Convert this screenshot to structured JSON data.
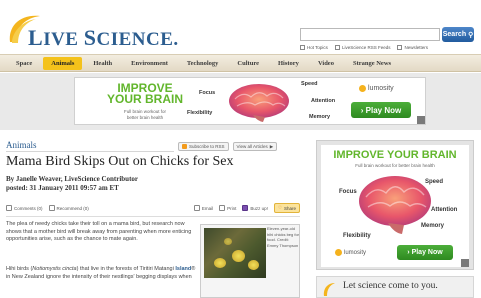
{
  "header": {
    "logo_text_part1": "L",
    "logo_text_part2": "IVE ",
    "logo_text_part3": "S",
    "logo_text_part4": "CIENCE",
    "logo_text_part5": ".",
    "search_value": "",
    "search_button_label": "Search",
    "links": [
      "Hot Topics",
      "LiveScience RSS Feeds",
      "Newsletters"
    ]
  },
  "nav": {
    "items": [
      "Space",
      "Animals",
      "Health",
      "Environment",
      "Technology",
      "Culture",
      "History",
      "Video",
      "Strange News"
    ],
    "active": "Animals"
  },
  "banner": {
    "headline_line1": "IMPROVE",
    "headline_line2": "YOUR BRAIN",
    "sub_line1": "Full brain workout for",
    "sub_line2": "better brain health",
    "labels": [
      "Focus",
      "Speed",
      "Attention",
      "Flexibility",
      "Memory"
    ],
    "brand": "lumosity",
    "cta": "› Play Now"
  },
  "article": {
    "section": "Animals",
    "subscribe_label": "Subscribe to RSS",
    "view_all_label": "View all Articles",
    "title": "Mama Bird Skips Out on Chicks for Sex",
    "byline": "By Janelle Weaver, LiveScience Contributor",
    "posted": "posted: 31 January 2011 09:57 am ET",
    "tools": {
      "comments": "Comments (0)",
      "recommend": "Recommend (0)",
      "email": "Email",
      "print": "Print",
      "buzz": "Buzz up!",
      "share": "Share"
    },
    "para1": "The plea of needy chicks take their toll on a mama bird, but research now shows that a mother bird will break away from parenting when more enticing opportunities arise, such as the chance to mate again.",
    "para2_prefix": "Hihi birds (",
    "para2_latin": "Notiomystis cincta",
    "para2_mid": ") that live in the forests of Tiritiri Matangi ",
    "para2_link": "Island",
    "para2_suffix": "® in New Zealand ignore the intensity of their nestlings' begging displays when",
    "photo_caption": "Eleven-year-old hihi chicks beg for food. Credit: Emmy Thompson"
  },
  "right_ad": {
    "title": "IMPROVE YOUR BRAIN",
    "sub": "Full brain workout for better brain health",
    "labels": [
      "Speed",
      "Focus",
      "Attention",
      "Memory",
      "Flexibility"
    ],
    "brand": "lumosity",
    "cta": "› Play Now"
  },
  "promo": {
    "text": "Let science come to you."
  },
  "colors": {
    "brand_blue": "#2c5d8f",
    "nav_active": "#f4c21b",
    "ad_green": "#62b62c"
  }
}
